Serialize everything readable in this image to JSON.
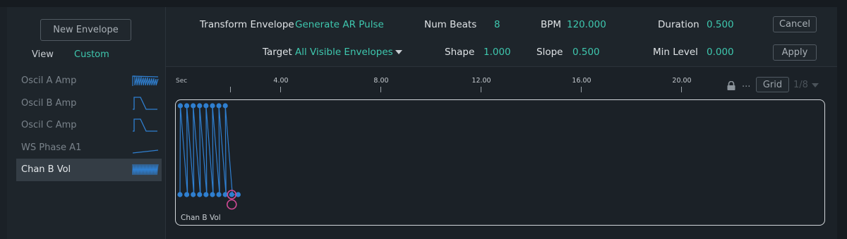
{
  "left_panel": {
    "new_envelope_label": "New Envelope",
    "view_label": "View",
    "view_value": "Custom",
    "envelopes": [
      {
        "label": "Oscil A Amp",
        "thumb": "sawtooth-ramp-icon",
        "selected": false
      },
      {
        "label": "Oscil B Amp",
        "thumb": "ar-pulse-icon",
        "selected": false
      },
      {
        "label": "Oscil C Amp",
        "thumb": "ar-pulse-icon",
        "selected": false
      },
      {
        "label": "WS Phase A1",
        "thumb": "linear-rise-icon",
        "selected": false
      },
      {
        "label": "Chan B Vol",
        "thumb": "dense-pulses-icon",
        "selected": true
      }
    ]
  },
  "toolbar": {
    "transform_label": "Transform Envelope",
    "transform_value": "Generate AR Pulse",
    "num_beats_label": "Num Beats",
    "num_beats_value": "8",
    "bpm_label": "BPM",
    "bpm_value": "120.000",
    "duration_label": "Duration",
    "duration_value": "0.500",
    "cancel_label": "Cancel",
    "target_label": "Target",
    "target_value": "All Visible Envelopes",
    "shape_label": "Shape",
    "shape_value": "1.000",
    "slope_label": "Slope",
    "slope_value": "0.500",
    "min_level_label": "Min Level",
    "min_level_value": "0.000",
    "apply_label": "Apply"
  },
  "editor": {
    "ruler_unit": "Sec",
    "ruler_labels": [
      "4.00",
      "8.00",
      "12.00",
      "16.00",
      "20.00"
    ],
    "lock_icon": "lock-icon",
    "more_label": "...",
    "grid_label": "Grid",
    "grid_value": "1/8",
    "envelope_name": "Chan B Vol",
    "pulse_count": 8,
    "colors": {
      "accent": "#3ec7ae",
      "curve": "#2f7fd0",
      "cursor": "#d24a96"
    }
  }
}
